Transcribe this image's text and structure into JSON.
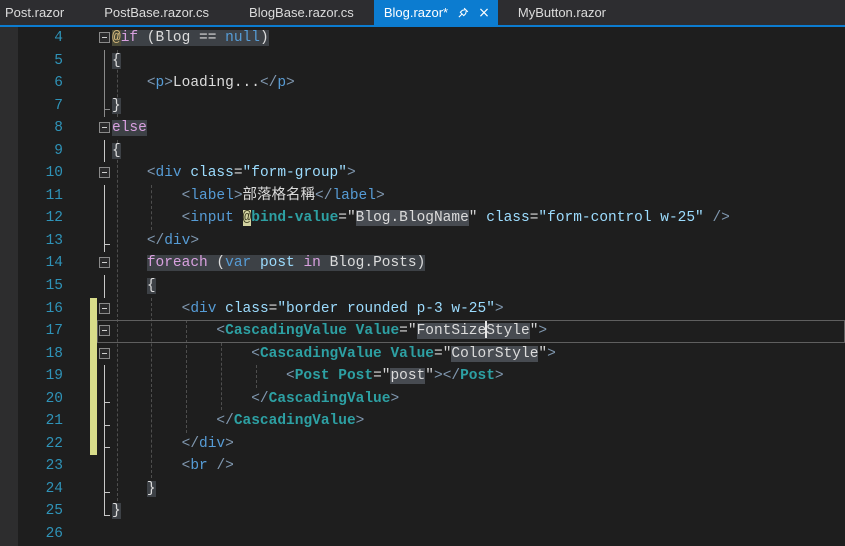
{
  "tab_bar": {
    "close_glyph": "×",
    "tabs": [
      {
        "label": "Post.razor",
        "active": false
      },
      {
        "label": "PostBase.razor.cs",
        "active": false
      },
      {
        "label": "BlogBase.razor.cs",
        "active": false
      },
      {
        "label": "Blog.razor*",
        "active": true,
        "icons": [
          "pin-icon",
          "close-icon"
        ]
      },
      {
        "label": "MyButton.razor",
        "active": false
      }
    ]
  },
  "editor": {
    "language": "razor",
    "current_line": 17,
    "caret": {
      "line": 17,
      "after_text": "FontSize"
    },
    "changed_lines": [
      16,
      17,
      18,
      19,
      20,
      21,
      22
    ],
    "lines": [
      {
        "n": 4,
        "fold": "start",
        "tokens": [
          {
            "t": "@",
            "c": "atgold",
            "bg": "atgoldbg"
          },
          {
            "t": "if",
            "c": "kw",
            "bg": "code"
          },
          {
            "t": " (",
            "c": "plain",
            "bg": "code"
          },
          {
            "t": "Blog",
            "c": "plain",
            "bg": "code"
          },
          {
            "t": " == ",
            "c": "plain",
            "bg": "code"
          },
          {
            "t": "null",
            "c": "kwb",
            "bg": "code"
          },
          {
            "t": ")",
            "c": "plain",
            "bg": "code"
          }
        ]
      },
      {
        "n": 5,
        "fold": "line",
        "tokens": [
          {
            "t": "{",
            "c": "plain",
            "bg": "code"
          }
        ]
      },
      {
        "n": 6,
        "fold": "line",
        "tokens": [
          {
            "t": "    ",
            "c": "plain"
          },
          {
            "t": "<",
            "c": "delim"
          },
          {
            "t": "p",
            "c": "tag"
          },
          {
            "t": ">",
            "c": "delim"
          },
          {
            "t": "Loading...",
            "c": "plain"
          },
          {
            "t": "</",
            "c": "delim"
          },
          {
            "t": "p",
            "c": "tag"
          },
          {
            "t": ">",
            "c": "delim"
          }
        ]
      },
      {
        "n": 7,
        "fold": "end",
        "tokens": [
          {
            "t": "}",
            "c": "plain",
            "bg": "code"
          }
        ]
      },
      {
        "n": 8,
        "fold": "start",
        "tokens": [
          {
            "t": "else",
            "c": "kw",
            "bg": "code"
          }
        ]
      },
      {
        "n": 9,
        "fold": "line",
        "tokens": [
          {
            "t": "{",
            "c": "plain",
            "bg": "code"
          }
        ]
      },
      {
        "n": 10,
        "fold": "start",
        "tokens": [
          {
            "t": "    ",
            "c": "plain"
          },
          {
            "t": "<",
            "c": "delim"
          },
          {
            "t": "div",
            "c": "tag"
          },
          {
            "t": " ",
            "c": "plain"
          },
          {
            "t": "class",
            "c": "attr"
          },
          {
            "t": "=",
            "c": "plain"
          },
          {
            "t": "\"form-group\"",
            "c": "str"
          },
          {
            "t": ">",
            "c": "delim"
          }
        ]
      },
      {
        "n": 11,
        "fold": "line",
        "tokens": [
          {
            "t": "        ",
            "c": "plain"
          },
          {
            "t": "<",
            "c": "delim"
          },
          {
            "t": "label",
            "c": "tag"
          },
          {
            "t": ">",
            "c": "delim"
          },
          {
            "t": "部落格名稱",
            "c": "plain"
          },
          {
            "t": "</",
            "c": "delim"
          },
          {
            "t": "label",
            "c": "tag"
          },
          {
            "t": ">",
            "c": "delim"
          }
        ]
      },
      {
        "n": 12,
        "fold": "line",
        "tokens": [
          {
            "t": "        ",
            "c": "plain"
          },
          {
            "t": "<",
            "c": "delim"
          },
          {
            "t": "input",
            "c": "tag"
          },
          {
            "t": " ",
            "c": "plain"
          },
          {
            "t": "@",
            "c": "atdark",
            "bg": "atbg"
          },
          {
            "t": "bind-value",
            "c": "comp"
          },
          {
            "t": "=",
            "c": "plain"
          },
          {
            "t": "\"",
            "c": "cstr"
          },
          {
            "t": "Blog.BlogName",
            "c": "plain",
            "bg": "hl"
          },
          {
            "t": "\"",
            "c": "cstr"
          },
          {
            "t": " ",
            "c": "plain"
          },
          {
            "t": "class",
            "c": "attr"
          },
          {
            "t": "=",
            "c": "plain"
          },
          {
            "t": "\"form-control w-25\"",
            "c": "str"
          },
          {
            "t": " ",
            "c": "plain"
          },
          {
            "t": "/>",
            "c": "delim"
          }
        ]
      },
      {
        "n": 13,
        "fold": "end",
        "tokens": [
          {
            "t": "    ",
            "c": "plain"
          },
          {
            "t": "</",
            "c": "delim"
          },
          {
            "t": "div",
            "c": "tag"
          },
          {
            "t": ">",
            "c": "delim"
          }
        ]
      },
      {
        "n": 14,
        "fold": "start",
        "tokens": [
          {
            "t": "    ",
            "c": "plain"
          },
          {
            "t": "foreach",
            "c": "kw",
            "bg": "code"
          },
          {
            "t": " (",
            "c": "plain",
            "bg": "code"
          },
          {
            "t": "var",
            "c": "kwb",
            "bg": "code"
          },
          {
            "t": " ",
            "c": "plain",
            "bg": "code"
          },
          {
            "t": "post",
            "c": "attr",
            "bg": "code"
          },
          {
            "t": " ",
            "c": "plain",
            "bg": "code"
          },
          {
            "t": "in",
            "c": "kw",
            "bg": "code"
          },
          {
            "t": " ",
            "c": "plain",
            "bg": "code"
          },
          {
            "t": "Blog.Posts",
            "c": "plain",
            "bg": "code"
          },
          {
            "t": ")",
            "c": "plain",
            "bg": "code"
          }
        ]
      },
      {
        "n": 15,
        "fold": "line",
        "tokens": [
          {
            "t": "    ",
            "c": "plain"
          },
          {
            "t": "{",
            "c": "plain",
            "bg": "code"
          }
        ]
      },
      {
        "n": 16,
        "fold": "start",
        "tokens": [
          {
            "t": "        ",
            "c": "plain"
          },
          {
            "t": "<",
            "c": "delim"
          },
          {
            "t": "div",
            "c": "tag"
          },
          {
            "t": " ",
            "c": "plain"
          },
          {
            "t": "class",
            "c": "attr"
          },
          {
            "t": "=",
            "c": "plain"
          },
          {
            "t": "\"border rounded p-3 w-25\"",
            "c": "str"
          },
          {
            "t": ">",
            "c": "delim"
          }
        ]
      },
      {
        "n": 17,
        "fold": "start",
        "tokens": [
          {
            "t": "            ",
            "c": "plain"
          },
          {
            "t": "<",
            "c": "delim"
          },
          {
            "t": "CascadingValue",
            "c": "comp"
          },
          {
            "t": " ",
            "c": "plain"
          },
          {
            "t": "Value",
            "c": "comp"
          },
          {
            "t": "=",
            "c": "plain"
          },
          {
            "t": "\"",
            "c": "cstr"
          },
          {
            "t": "FontSize",
            "c": "plain",
            "bg": "hl"
          },
          {
            "t": "",
            "c": "caret"
          },
          {
            "t": "Style",
            "c": "plain",
            "bg": "hl"
          },
          {
            "t": "\"",
            "c": "cstr"
          },
          {
            "t": ">",
            "c": "delim"
          }
        ]
      },
      {
        "n": 18,
        "fold": "start",
        "tokens": [
          {
            "t": "                ",
            "c": "plain"
          },
          {
            "t": "<",
            "c": "delim"
          },
          {
            "t": "CascadingValue",
            "c": "comp"
          },
          {
            "t": " ",
            "c": "plain"
          },
          {
            "t": "Value",
            "c": "comp"
          },
          {
            "t": "=",
            "c": "plain"
          },
          {
            "t": "\"",
            "c": "cstr"
          },
          {
            "t": "ColorStyle",
            "c": "plain",
            "bg": "hl"
          },
          {
            "t": "\"",
            "c": "cstr"
          },
          {
            "t": ">",
            "c": "delim"
          }
        ]
      },
      {
        "n": 19,
        "fold": "line",
        "tokens": [
          {
            "t": "                    ",
            "c": "plain"
          },
          {
            "t": "<",
            "c": "delim"
          },
          {
            "t": "Post",
            "c": "comp"
          },
          {
            "t": " ",
            "c": "plain"
          },
          {
            "t": "Post",
            "c": "comp"
          },
          {
            "t": "=",
            "c": "plain"
          },
          {
            "t": "\"",
            "c": "cstr"
          },
          {
            "t": "post",
            "c": "plain",
            "bg": "hl"
          },
          {
            "t": "\"",
            "c": "cstr"
          },
          {
            "t": ">",
            "c": "delim"
          },
          {
            "t": "</",
            "c": "delim"
          },
          {
            "t": "Post",
            "c": "comp"
          },
          {
            "t": ">",
            "c": "delim"
          }
        ]
      },
      {
        "n": 20,
        "fold": "end",
        "tokens": [
          {
            "t": "                ",
            "c": "plain"
          },
          {
            "t": "</",
            "c": "delim"
          },
          {
            "t": "CascadingValue",
            "c": "comp"
          },
          {
            "t": ">",
            "c": "delim"
          }
        ]
      },
      {
        "n": 21,
        "fold": "end",
        "tokens": [
          {
            "t": "            ",
            "c": "plain"
          },
          {
            "t": "</",
            "c": "delim"
          },
          {
            "t": "CascadingValue",
            "c": "comp"
          },
          {
            "t": ">",
            "c": "delim"
          }
        ]
      },
      {
        "n": 22,
        "fold": "end",
        "tokens": [
          {
            "t": "        ",
            "c": "plain"
          },
          {
            "t": "</",
            "c": "delim"
          },
          {
            "t": "div",
            "c": "tag"
          },
          {
            "t": ">",
            "c": "delim"
          }
        ]
      },
      {
        "n": 23,
        "fold": "line",
        "tokens": [
          {
            "t": "        ",
            "c": "plain"
          },
          {
            "t": "<",
            "c": "delim"
          },
          {
            "t": "br",
            "c": "tag"
          },
          {
            "t": " ",
            "c": "plain"
          },
          {
            "t": "/>",
            "c": "delim"
          }
        ]
      },
      {
        "n": 24,
        "fold": "end",
        "tokens": [
          {
            "t": "    ",
            "c": "plain"
          },
          {
            "t": "}",
            "c": "plain",
            "bg": "code"
          }
        ]
      },
      {
        "n": 25,
        "fold": "last",
        "tokens": [
          {
            "t": "}",
            "c": "plain",
            "bg": "code"
          }
        ]
      },
      {
        "n": 26,
        "fold": "",
        "tokens": []
      }
    ]
  },
  "colors": {
    "bg": "#1E1E1E",
    "tabbar_bg": "#2D2D30",
    "tab_text": "#DCDCDC",
    "accent": "#0C7CD0",
    "text_plain": "#DCDCDC",
    "kw": "#D8A0DF",
    "kwb": "#569CD6",
    "tag": "#569CD6",
    "comp": "#2DA0A3",
    "attr": "#9CDCFE",
    "str": "#9CDCFE",
    "cstr": "#D4D4D4",
    "delim": "#8098B0",
    "linenum": "#2F93B8",
    "code_bg": "#3D4146",
    "hl_bg": "#474B51",
    "at_gold": "#D7BA7D",
    "at_gold_bg": "#4B4B38",
    "at_dark": "#3C3C20",
    "at_bg": "#D2D2A0",
    "changed": "#D8DC8A",
    "fold_bright": "#C8C8C8",
    "fold_dim": "#8A8A8A",
    "curline_border": "#5F5F5F",
    "guide": "#4E4E4E",
    "margin_strip": "#2D2D2E",
    "caret": "#E8E8E8"
  }
}
